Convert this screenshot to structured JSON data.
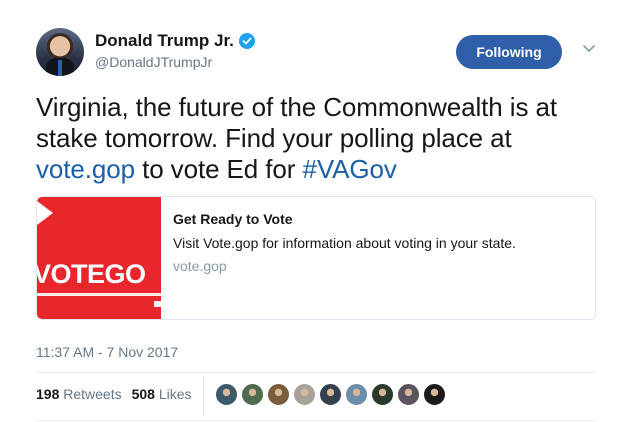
{
  "author": {
    "display_name": "Donald Trump Jr.",
    "handle": "@DonaldJTrumpJr",
    "verified": true
  },
  "follow_button_label": "Following",
  "tweet": {
    "text_part1": "Virginia, the future of the Commonwealth is at stake tomorrow. Find your polling place at ",
    "link1": "vote.gop",
    "text_part2": " to vote Ed for ",
    "hashtag": "#VAGov"
  },
  "card": {
    "image_logo_text": "VOTEGO",
    "title": "Get Ready to Vote",
    "description": "Visit Vote.gop for information about voting in your state.",
    "url": "vote.gop"
  },
  "timestamp": "11:37 AM - 7 Nov 2017",
  "stats": {
    "retweets_count": "198",
    "retweets_label": "Retweets",
    "likes_count": "508",
    "likes_label": "Likes"
  },
  "colors": {
    "accent": "#1b5fa8",
    "follow_button": "#2f5fa8",
    "card_image_red": "#e8262c",
    "verified_badge": "#1da1f2"
  },
  "liker_avatars": [
    {
      "color": "#3d5a6c"
    },
    {
      "color": "#4f6a4d"
    },
    {
      "color": "#7a5c3e"
    },
    {
      "color": "#a8a29b"
    },
    {
      "color": "#35404f"
    },
    {
      "color": "#6b8fa8"
    },
    {
      "color": "#2c3a2e"
    },
    {
      "color": "#5a5460"
    },
    {
      "color": "#1b1b1b"
    }
  ]
}
